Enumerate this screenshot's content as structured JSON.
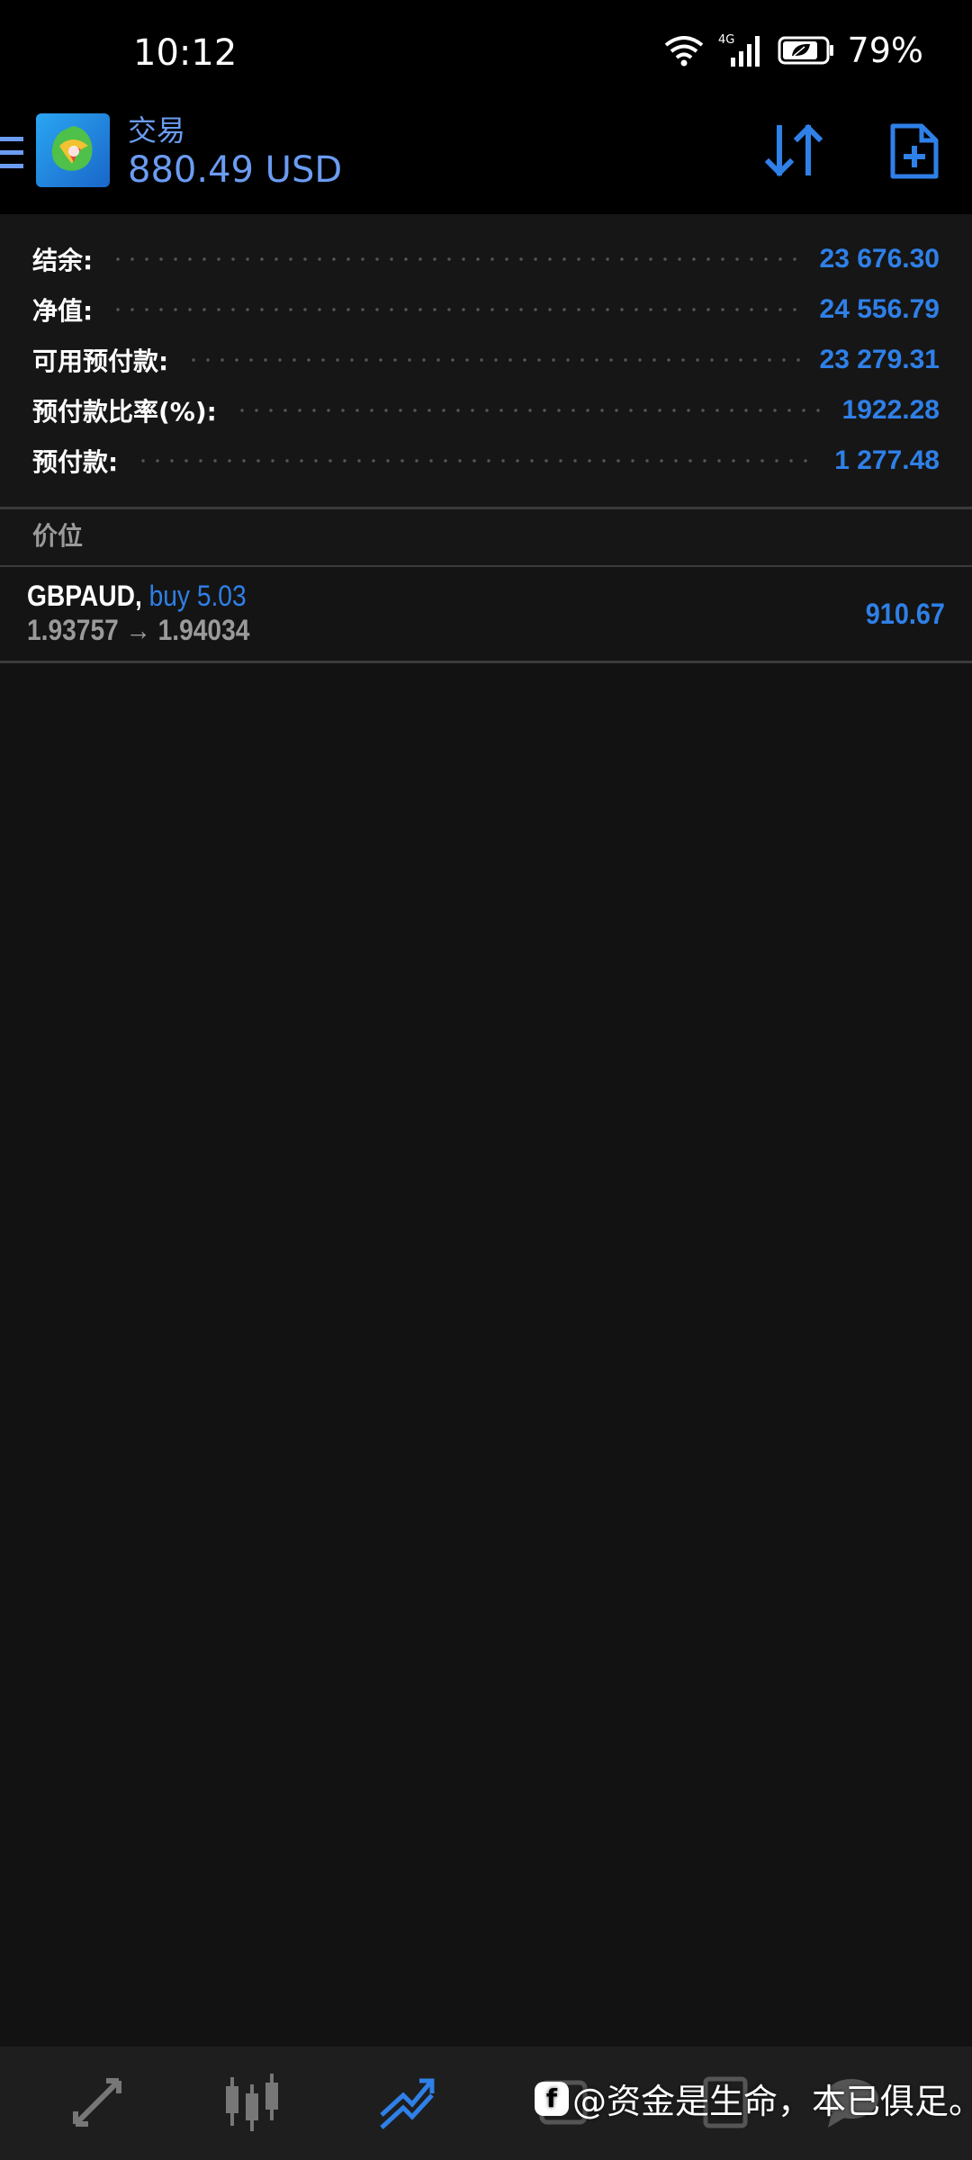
{
  "status_bar": {
    "time": "10:12",
    "network": "4G",
    "battery": "79%",
    "icons": [
      "wifi-icon",
      "signal-icon",
      "battery-leaf-icon"
    ]
  },
  "header": {
    "title": "交易",
    "balance": "880.49 USD",
    "icons": [
      "menu-icon",
      "app-logo",
      "sort-icon",
      "new-order-icon"
    ],
    "accent_color": "#6b9cf2"
  },
  "summary": {
    "rows": [
      {
        "label": "结余:",
        "value": "23 676.30"
      },
      {
        "label": "净值:",
        "value": "24 556.79"
      },
      {
        "label": "可用预付款:",
        "value": "23 279.31"
      },
      {
        "label": "预付款比率(%):",
        "value": "1922.28"
      },
      {
        "label": "预付款:",
        "value": "1 277.48"
      }
    ],
    "value_color": "#2f80e8"
  },
  "positions": {
    "section_title": "价位",
    "items": [
      {
        "symbol": "GBPAUD,",
        "side": "buy 5.03",
        "prices": "1.93757 → 1.94034",
        "profit": "910.67"
      }
    ]
  },
  "bottom_nav": {
    "items": [
      "quotes-icon",
      "chart-candles-icon",
      "trade-icon",
      "history-icon",
      "messages-icon"
    ],
    "active": "trade-icon"
  },
  "watermark": {
    "logo": "f",
    "text": "@资金是生命，本已俱足。"
  }
}
